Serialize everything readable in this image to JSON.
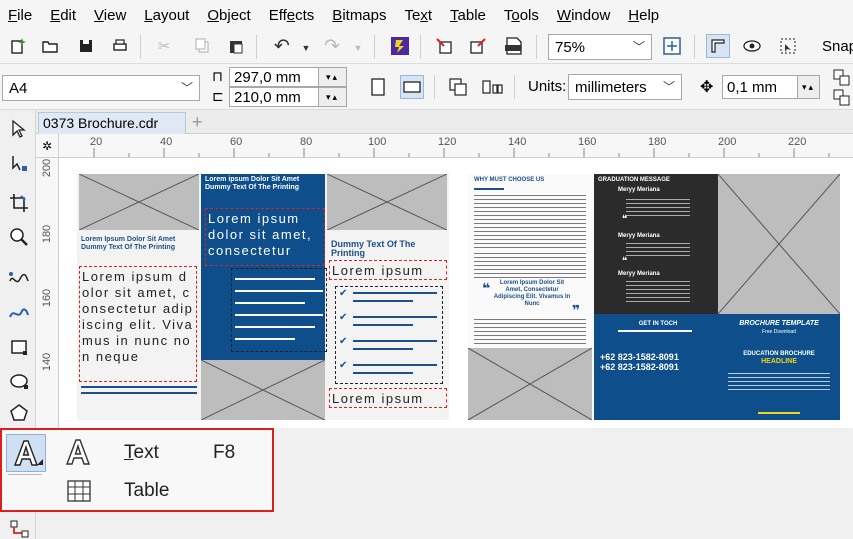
{
  "menu": {
    "items": [
      {
        "ul": "F",
        "rest": "ile"
      },
      {
        "ul": "E",
        "rest": "dit"
      },
      {
        "ul": "V",
        "rest": "iew"
      },
      {
        "ul": "L",
        "rest": "ayout"
      },
      {
        "ul": "O",
        "rest": "bject"
      },
      {
        "ul": "",
        "pre": "Eff",
        "mid": "e",
        "rest": "cts"
      },
      {
        "ul": "B",
        "rest": "itmaps"
      },
      {
        "ul": "",
        "pre": "Te",
        "mid": "x",
        "rest": "t"
      },
      {
        "ul": "T",
        "rest": "able"
      },
      {
        "ul": "",
        "pre": "T",
        "mid": "o",
        "rest": "ols"
      },
      {
        "ul": "W",
        "rest": "indow"
      },
      {
        "ul": "H",
        "rest": "elp"
      }
    ]
  },
  "toolbar": {
    "zoom_value": "75%",
    "snap_label": "Snap"
  },
  "property_bar": {
    "page_size": "A4",
    "width_value": "297,0 mm",
    "height_value": "210,0 mm",
    "units_label": "Units:",
    "units_value": "millimeters",
    "nudge_value": "0,1 mm"
  },
  "document_tab": {
    "title": "0373 Brochure.cdr",
    "add_symbol": "+"
  },
  "ruler": {
    "h_ticks": [
      "20",
      "40",
      "60",
      "80",
      "100",
      "120",
      "140",
      "160",
      "180",
      "200",
      "220"
    ],
    "v_ticks": [
      "200",
      "180",
      "160",
      "140"
    ]
  },
  "brochure_left": {
    "panel1_heading": "Lorem Ipsum Dolor Sit Amet Dummy Text Of The Printing",
    "panel1_body": "Lorem ipsum dolor sit amet, consectetur adipiscing elit. Vivamus in nunc non neque",
    "panel2_heading": "Lorem ipsum Dolor Sit Amet Dummy Text Of The Printing",
    "panel2_body": "Lorem ipsum dolor sit amet, consectetur",
    "panel3_heading": "Dummy Text Of The Printing",
    "panel3_body_top": "Lorem ipsum",
    "panel3_body_bottom": "Lorem ipsum"
  },
  "brochure_right": {
    "why_heading": "WHY MUST CHOOSE US",
    "quote_text": "Lorem Ipsum Dolor Sit Amet, Consectetur Adipiscing Elit. Vivamus In Nunc",
    "grad_heading": "GRADUATION MESSAGE",
    "person1": "Meryy Meriana",
    "person2": "Meryy Meriana",
    "person3": "Meryy Meriana",
    "get_in_touch": "GET IN TOCH",
    "phone1": "+62 823-1582-8091",
    "phone2": "+62 823-1582-8091",
    "brochure_template": "BROCHURE TEMPLATE",
    "free_download": "Free Download",
    "education": "EDUCATION BROCHURE",
    "headline": "HEADLINE"
  },
  "flyout": {
    "text_label_ul": "T",
    "text_label_rest": "ext",
    "text_shortcut": "F8",
    "table_label": "Table"
  },
  "colors": {
    "brand_blue": "#0e4f8b",
    "dark_panel": "#2b2b2b",
    "highlight_red": "#dd1e1e",
    "accent_yellow": "#f2d21b"
  }
}
